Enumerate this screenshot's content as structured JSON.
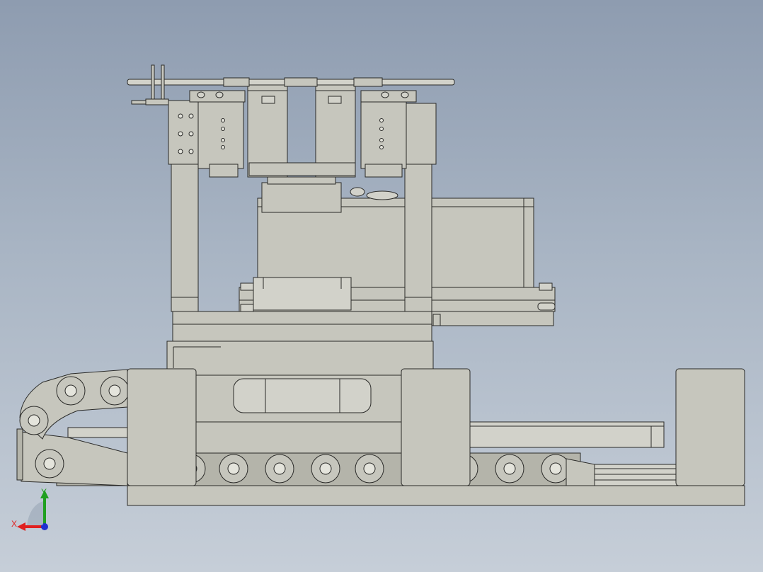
{
  "viewport": {
    "background_top": "#8e9cb0",
    "background_bottom": "#c6ced8",
    "part_color": "#c6c6bd",
    "edge_color": "#2a2a28"
  },
  "triad": {
    "x_label": "X",
    "y_label": "Y",
    "x_color": "#e02020",
    "y_color": "#20a020",
    "z_color": "#2030d0"
  }
}
